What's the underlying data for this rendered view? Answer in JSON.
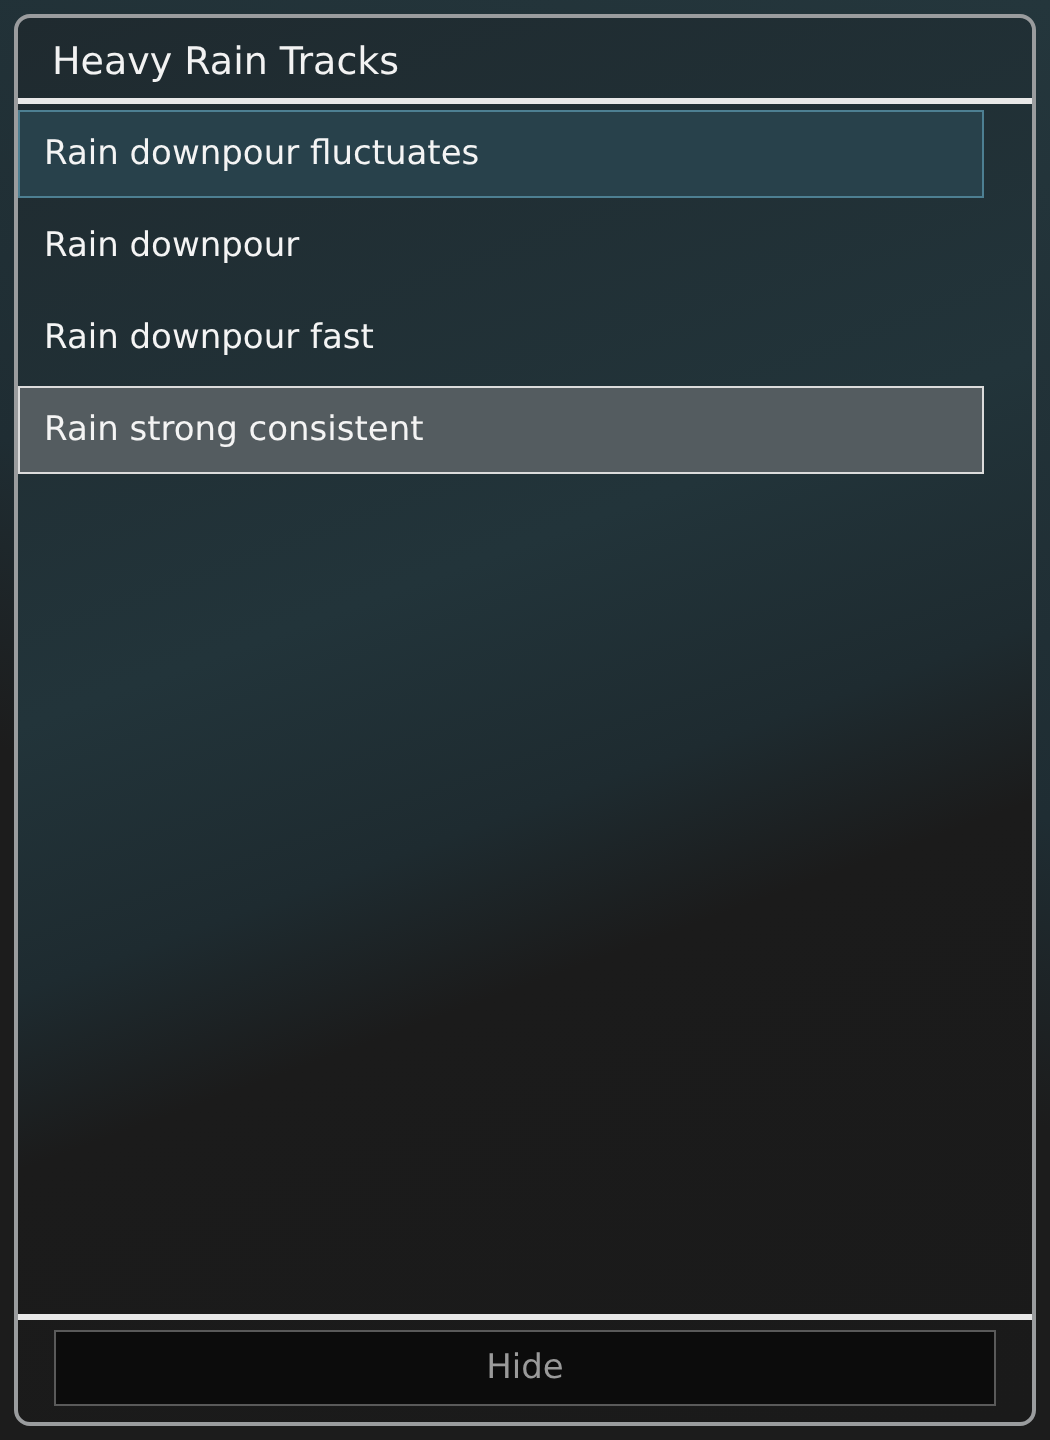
{
  "window": {
    "title": "Heavy Rain Tracks"
  },
  "tracks": [
    {
      "label": "Rain downpour fluctuates",
      "selected": true,
      "focused": false
    },
    {
      "label": "Rain downpour",
      "selected": false,
      "focused": false
    },
    {
      "label": "Rain downpour fast",
      "selected": false,
      "focused": false
    },
    {
      "label": "Rain strong consistent",
      "selected": false,
      "focused": true
    }
  ],
  "buttons": [
    {
      "label": "Hide"
    }
  ]
}
